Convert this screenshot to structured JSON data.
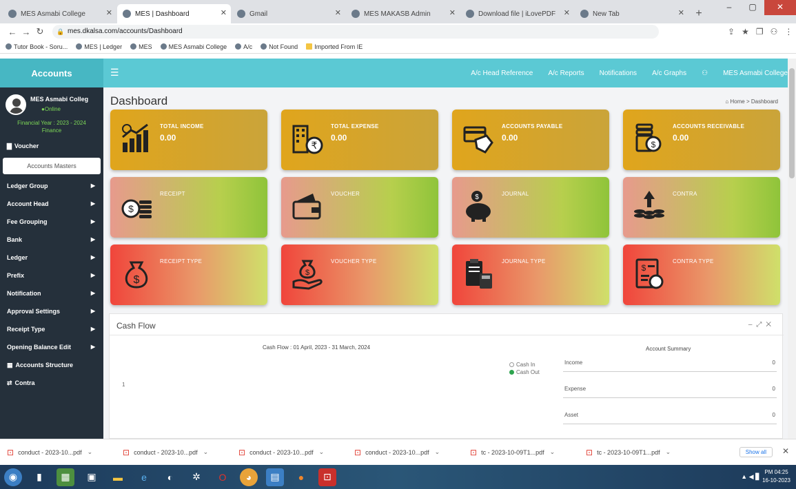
{
  "browser": {
    "tabs": [
      {
        "title": "MES Asmabi College",
        "active": false
      },
      {
        "title": "MES | Dashboard",
        "active": true
      },
      {
        "title": "Gmail",
        "active": false
      },
      {
        "title": "MES MAKASB Admin",
        "active": false
      },
      {
        "title": "Download file | iLovePDF",
        "active": false
      },
      {
        "title": "New Tab",
        "active": false
      }
    ],
    "url": "mes.dkalsa.com/accounts/Dashboard",
    "bookmarks": [
      "Tutor Book - Soru...",
      "MES | Ledger",
      "MES",
      "MES Asmabi College",
      "A/c",
      "Not Found",
      "Imported From IE"
    ]
  },
  "app": {
    "brand": "Accounts",
    "topnav": [
      "A/c Head Reference",
      "A/c Reports",
      "Notifications",
      "A/c Graphs",
      "MES Asmabi College"
    ]
  },
  "sidebar": {
    "user_name": "MES Asmabi Colleg",
    "status": "Online",
    "financial_year": "Financial Year : 2023 - 2024",
    "financial_sub": "Finance",
    "voucher": "Voucher",
    "accounts_masters": "Accounts Masters",
    "items": [
      "Ledger Group",
      "Account Head",
      "Fee Grouping",
      "Bank",
      "Ledger",
      "Prefix",
      "Notification",
      "Approval Settings",
      "Receipt Type",
      "Opening Balance Edit"
    ],
    "accounts_structure": "Accounts Structure",
    "contra": "Contra"
  },
  "page": {
    "title": "Dashboard",
    "breadcrumb": "Home > Dashboard"
  },
  "cards": [
    {
      "label": "TOTAL INCOME",
      "value": "0.00",
      "icon": "income-chart-icon"
    },
    {
      "label": "TOTAL EXPENSE",
      "value": "0.00",
      "icon": "expense-building-icon"
    },
    {
      "label": "ACCOUNTS PAYABLE",
      "value": "0.00",
      "icon": "payable-card-icon"
    },
    {
      "label": "ACCOUNTS RECEIVABLE",
      "value": "0.00",
      "icon": "receivable-coins-icon"
    },
    {
      "label": "RECEIPT",
      "value": "",
      "icon": "receipt-coins-icon"
    },
    {
      "label": "VOUCHER",
      "value": "",
      "icon": "voucher-wallet-icon"
    },
    {
      "label": "JOURNAL",
      "value": "",
      "icon": "journal-piggy-icon"
    },
    {
      "label": "CONTRA",
      "value": "",
      "icon": "contra-coins-icon"
    },
    {
      "label": "RECEIPT TYPE",
      "value": "",
      "icon": "moneybag-icon"
    },
    {
      "label": "VOUCHER TYPE",
      "value": "",
      "icon": "hand-money-icon"
    },
    {
      "label": "JOURNAL TYPE",
      "value": "",
      "icon": "clipboard-calculator-icon"
    },
    {
      "label": "CONTRA TYPE",
      "value": "",
      "icon": "document-coin-icon"
    }
  ],
  "cashflow": {
    "panel_title": "Cash Flow",
    "chart_title": "Cash Flow : 01 April, 2023 - 31 March, 2024",
    "axis_label": "1",
    "legend": [
      {
        "name": "Cash In",
        "color": "#ffffff"
      },
      {
        "name": "Cash Out",
        "color": "#2ea44f"
      }
    ],
    "summary_title": "Account Summary",
    "summary": [
      {
        "label": "Income",
        "value": "0"
      },
      {
        "label": "Expense",
        "value": "0"
      },
      {
        "label": "Asset",
        "value": "0"
      }
    ]
  },
  "downloads": [
    "conduct - 2023-10...pdf",
    "conduct - 2023-10...pdf",
    "conduct - 2023-10...pdf",
    "conduct - 2023-10...pdf",
    "tc - 2023-10-09T1...pdf",
    "tc - 2023-10-09T1...pdf"
  ],
  "download_showall": "Show all",
  "clock": {
    "time": "PM 04:25",
    "date": "16-10-2023"
  }
}
